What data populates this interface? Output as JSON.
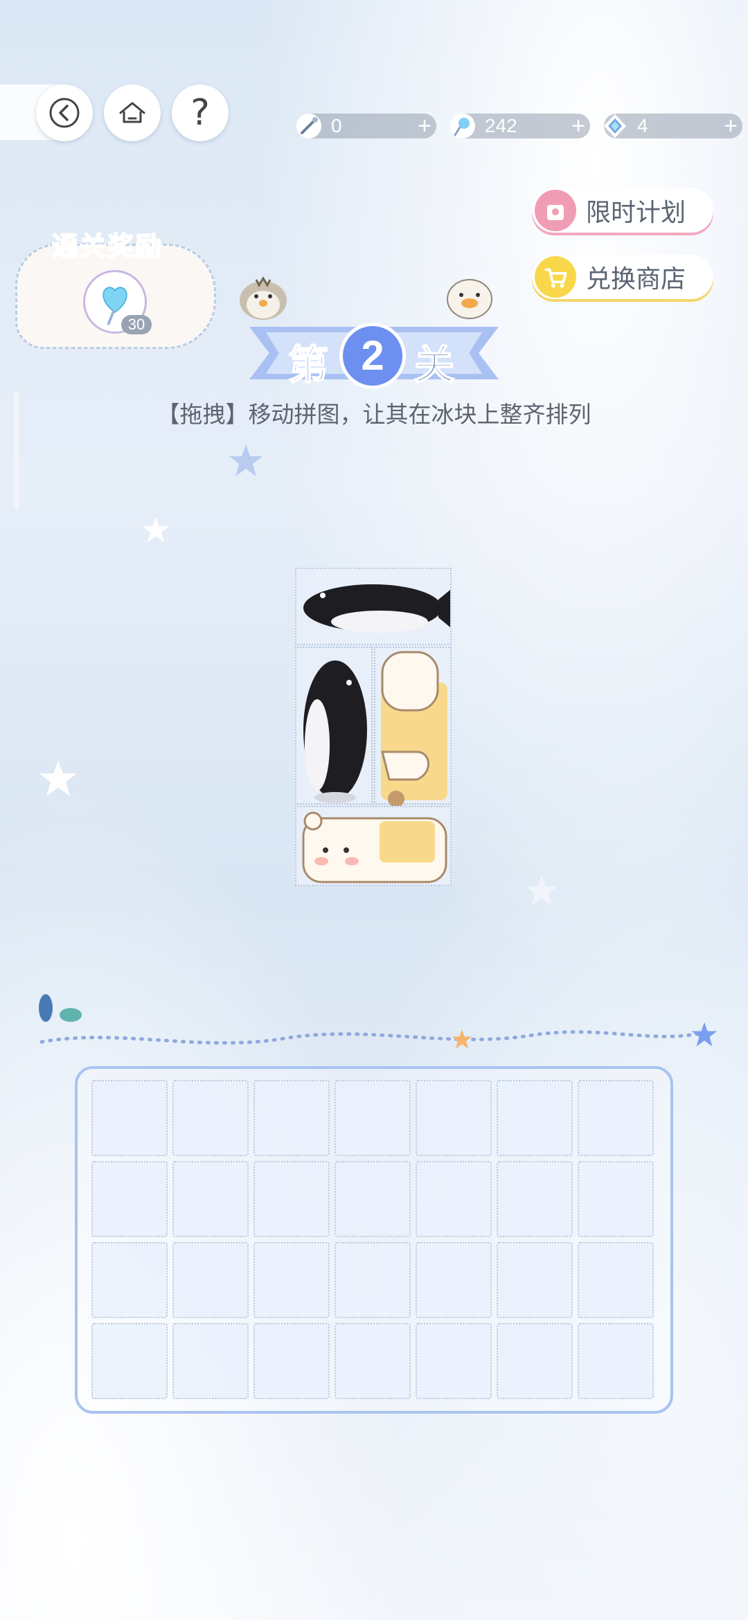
{
  "topbar": {
    "back_icon": "chevron-left-icon",
    "home_icon": "home-icon",
    "help_label": "?"
  },
  "resources": [
    {
      "name": "wand",
      "icon": "magic-wand-icon",
      "value": "0",
      "plus": "+"
    },
    {
      "name": "lollipop",
      "icon": "lollipop-icon",
      "value": "242",
      "plus": "+"
    },
    {
      "name": "crystal",
      "icon": "crystal-icon",
      "value": "4",
      "plus": "+"
    }
  ],
  "side_buttons": {
    "limited_plan": "限时计划",
    "exchange_shop": "兑换商店"
  },
  "reward": {
    "title": "通关奖励",
    "item_icon": "heart-lollipop-icon",
    "count": "30"
  },
  "level": {
    "prefix": "第",
    "number": "2",
    "suffix": "关"
  },
  "instruction": "【拖拽】移动拼图，让其在冰块上整齐排列",
  "puzzle_pieces": [
    {
      "name": "penguin-lying",
      "icon": "penguin-icon"
    },
    {
      "name": "penguin-standing",
      "icon": "penguin-icon"
    },
    {
      "name": "bear-legs",
      "icon": "polar-bear-icon"
    },
    {
      "name": "bear-face",
      "icon": "polar-bear-icon"
    }
  ],
  "board": {
    "rows": 4,
    "cols": 7
  },
  "colors": {
    "accent_blue": "#6d8ff0",
    "reward_orange": "#f6a25e",
    "pink_button": "#f19cb5",
    "yellow_button": "#f8d84a"
  }
}
